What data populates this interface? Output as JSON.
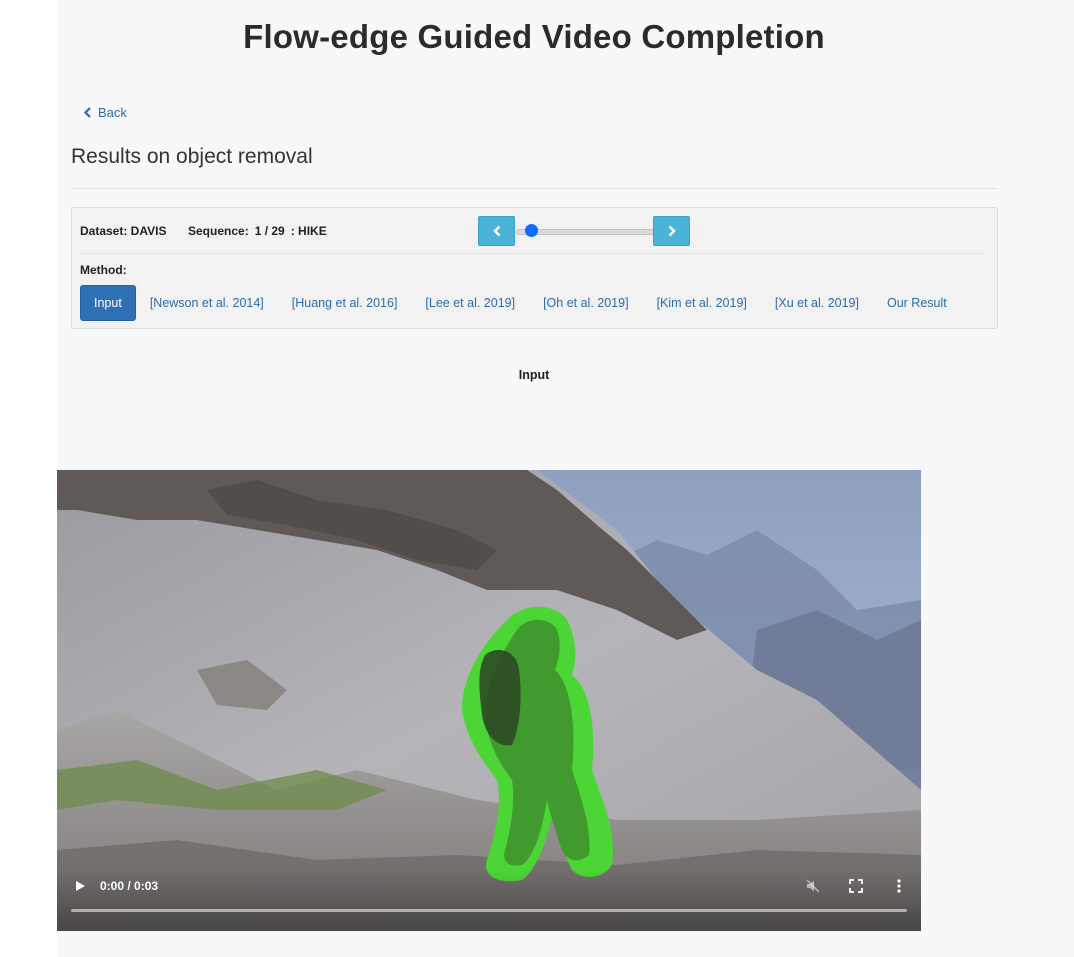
{
  "page": {
    "title": "Flow-edge Guided Video Completion",
    "back_label": "Back",
    "section_title": "Results on object removal"
  },
  "panel": {
    "dataset_label": "Dataset: DAVIS",
    "sequence_label": "Sequence:",
    "sequence_position": "1 / 29",
    "sequence_name": ": HIKE",
    "slider_progress": 0.08,
    "method_label": "Method:",
    "methods": [
      {
        "label": "Input",
        "active": true
      },
      {
        "label": "[Newson et al. 2014]",
        "active": false
      },
      {
        "label": "[Huang et al. 2016]",
        "active": false
      },
      {
        "label": "[Lee et al. 2019]",
        "active": false
      },
      {
        "label": "[Oh et al. 2019]",
        "active": false
      },
      {
        "label": "[Kim et al. 2019]",
        "active": false
      },
      {
        "label": "[Xu et al. 2019]",
        "active": false
      },
      {
        "label": "Our Result",
        "active": false
      }
    ]
  },
  "video": {
    "caption": "Input",
    "time": "0:00 / 0:03",
    "progress": 0.0,
    "mask_color": "#4cd636",
    "icons": [
      "play-icon",
      "mute-icon",
      "fullscreen-icon",
      "more-options-icon"
    ]
  },
  "colors": {
    "link": "#2a6cb0",
    "active_method": "#2f6fb3",
    "nav_button": "#4bb3d8",
    "slider_thumb": "#0d6efd"
  }
}
